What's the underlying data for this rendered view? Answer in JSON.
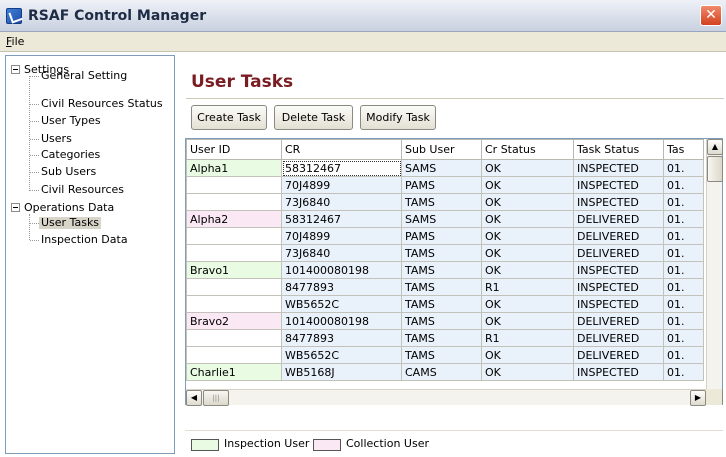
{
  "window": {
    "title": "RSAF Control Manager",
    "close_glyph": "✕"
  },
  "menu": {
    "file_label": "File"
  },
  "tree": {
    "settings": {
      "label": "Settings",
      "children": [
        "General Setting",
        "Civil Resources Status",
        "User Types",
        "Users",
        "Categories",
        "Sub Users",
        "Civil Resources"
      ]
    },
    "operations": {
      "label": "Operations Data",
      "children": [
        "User Tasks",
        "Inspection Data"
      ],
      "selected": "User Tasks"
    }
  },
  "main": {
    "title": "User Tasks",
    "buttons": {
      "create": "Create Task",
      "delete": "Delete Task",
      "modify": "Modify Task"
    }
  },
  "table": {
    "columns": [
      "User ID",
      "CR",
      "Sub User",
      "Cr Status",
      "Task Status",
      "Tas"
    ],
    "rows": [
      {
        "user_id": "Alpha1",
        "user_type": "inspection",
        "cr": "58312467",
        "sub_user": "SAMS",
        "cr_status": "OK",
        "task_status": "INSPECTED",
        "tas": "01."
      },
      {
        "user_id": "",
        "user_type": "",
        "cr": "70J4899",
        "sub_user": "PAMS",
        "cr_status": "OK",
        "task_status": "INSPECTED",
        "tas": "01."
      },
      {
        "user_id": "",
        "user_type": "",
        "cr": "73J6840",
        "sub_user": "TAMS",
        "cr_status": "OK",
        "task_status": "INSPECTED",
        "tas": "01."
      },
      {
        "user_id": "Alpha2",
        "user_type": "collection",
        "cr": "58312467",
        "sub_user": "SAMS",
        "cr_status": "OK",
        "task_status": "DELIVERED",
        "tas": "01."
      },
      {
        "user_id": "",
        "user_type": "",
        "cr": "70J4899",
        "sub_user": "PAMS",
        "cr_status": "OK",
        "task_status": "DELIVERED",
        "tas": "01."
      },
      {
        "user_id": "",
        "user_type": "",
        "cr": "73J6840",
        "sub_user": "TAMS",
        "cr_status": "OK",
        "task_status": "DELIVERED",
        "tas": "01."
      },
      {
        "user_id": "Bravo1",
        "user_type": "inspection",
        "cr": "101400080198",
        "sub_user": "TAMS",
        "cr_status": "OK",
        "task_status": "INSPECTED",
        "tas": "01."
      },
      {
        "user_id": "",
        "user_type": "",
        "cr": "8477893",
        "sub_user": "TAMS",
        "cr_status": "R1",
        "task_status": "INSPECTED",
        "tas": "01."
      },
      {
        "user_id": "",
        "user_type": "",
        "cr": "WB5652C",
        "sub_user": "TAMS",
        "cr_status": "OK",
        "task_status": "INSPECTED",
        "tas": "01."
      },
      {
        "user_id": "Bravo2",
        "user_type": "collection",
        "cr": "101400080198",
        "sub_user": "TAMS",
        "cr_status": "OK",
        "task_status": "DELIVERED",
        "tas": "01."
      },
      {
        "user_id": "",
        "user_type": "",
        "cr": "8477893",
        "sub_user": "TAMS",
        "cr_status": "R1",
        "task_status": "DELIVERED",
        "tas": "01."
      },
      {
        "user_id": "",
        "user_type": "",
        "cr": "WB5652C",
        "sub_user": "TAMS",
        "cr_status": "OK",
        "task_status": "DELIVERED",
        "tas": "01."
      },
      {
        "user_id": "Charlie1",
        "user_type": "inspection",
        "cr": "WB5168J",
        "sub_user": "CAMS",
        "cr_status": "OK",
        "task_status": "INSPECTED",
        "tas": "01."
      }
    ]
  },
  "legend": {
    "inspection": "Inspection User",
    "collection": "Collection User"
  },
  "colors": {
    "title_accent": "#7a1d22",
    "inspection_user": "#e9fbe3",
    "collection_user": "#fbe8f5",
    "cell_background": "#e9f1fb"
  }
}
